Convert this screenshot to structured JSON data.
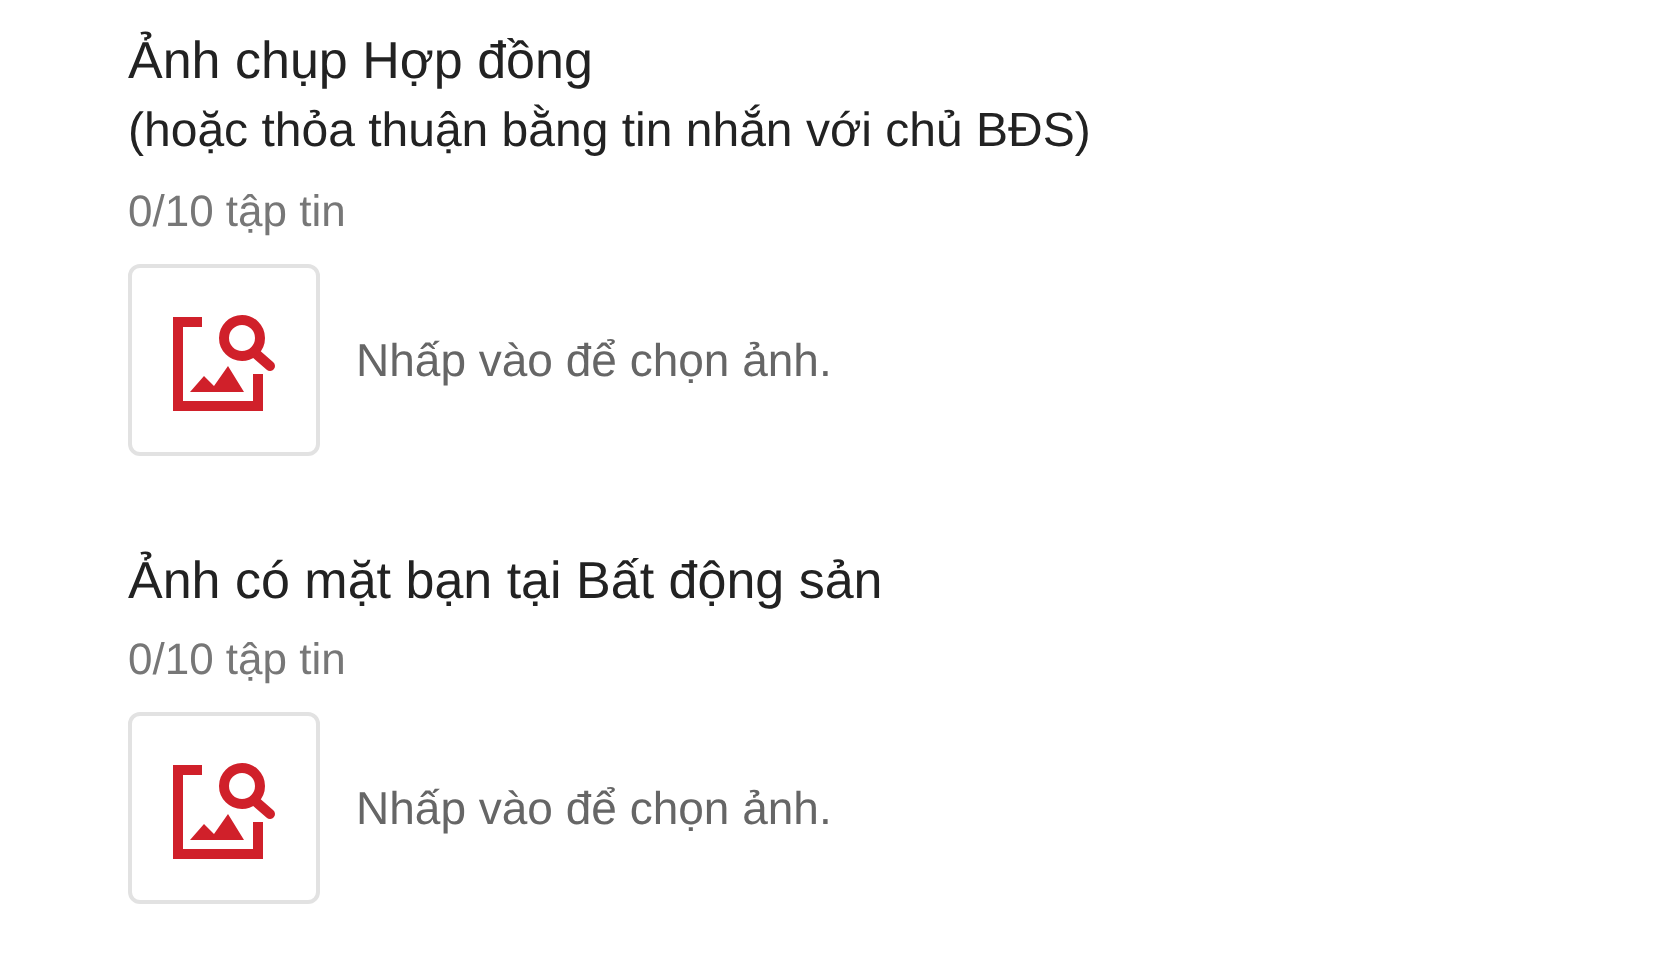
{
  "sections": [
    {
      "title": "Ảnh chụp Hợp đồng",
      "subtitle": "(hoặc thỏa thuận bằng tin nhắn với chủ BĐS)",
      "count": "0/10 tập tin",
      "hint": "Nhấp vào để chọn ảnh."
    },
    {
      "title": "Ảnh có mặt bạn tại Bất động sản",
      "count": "0/10 tập tin",
      "hint": "Nhấp vào để chọn ảnh."
    }
  ]
}
